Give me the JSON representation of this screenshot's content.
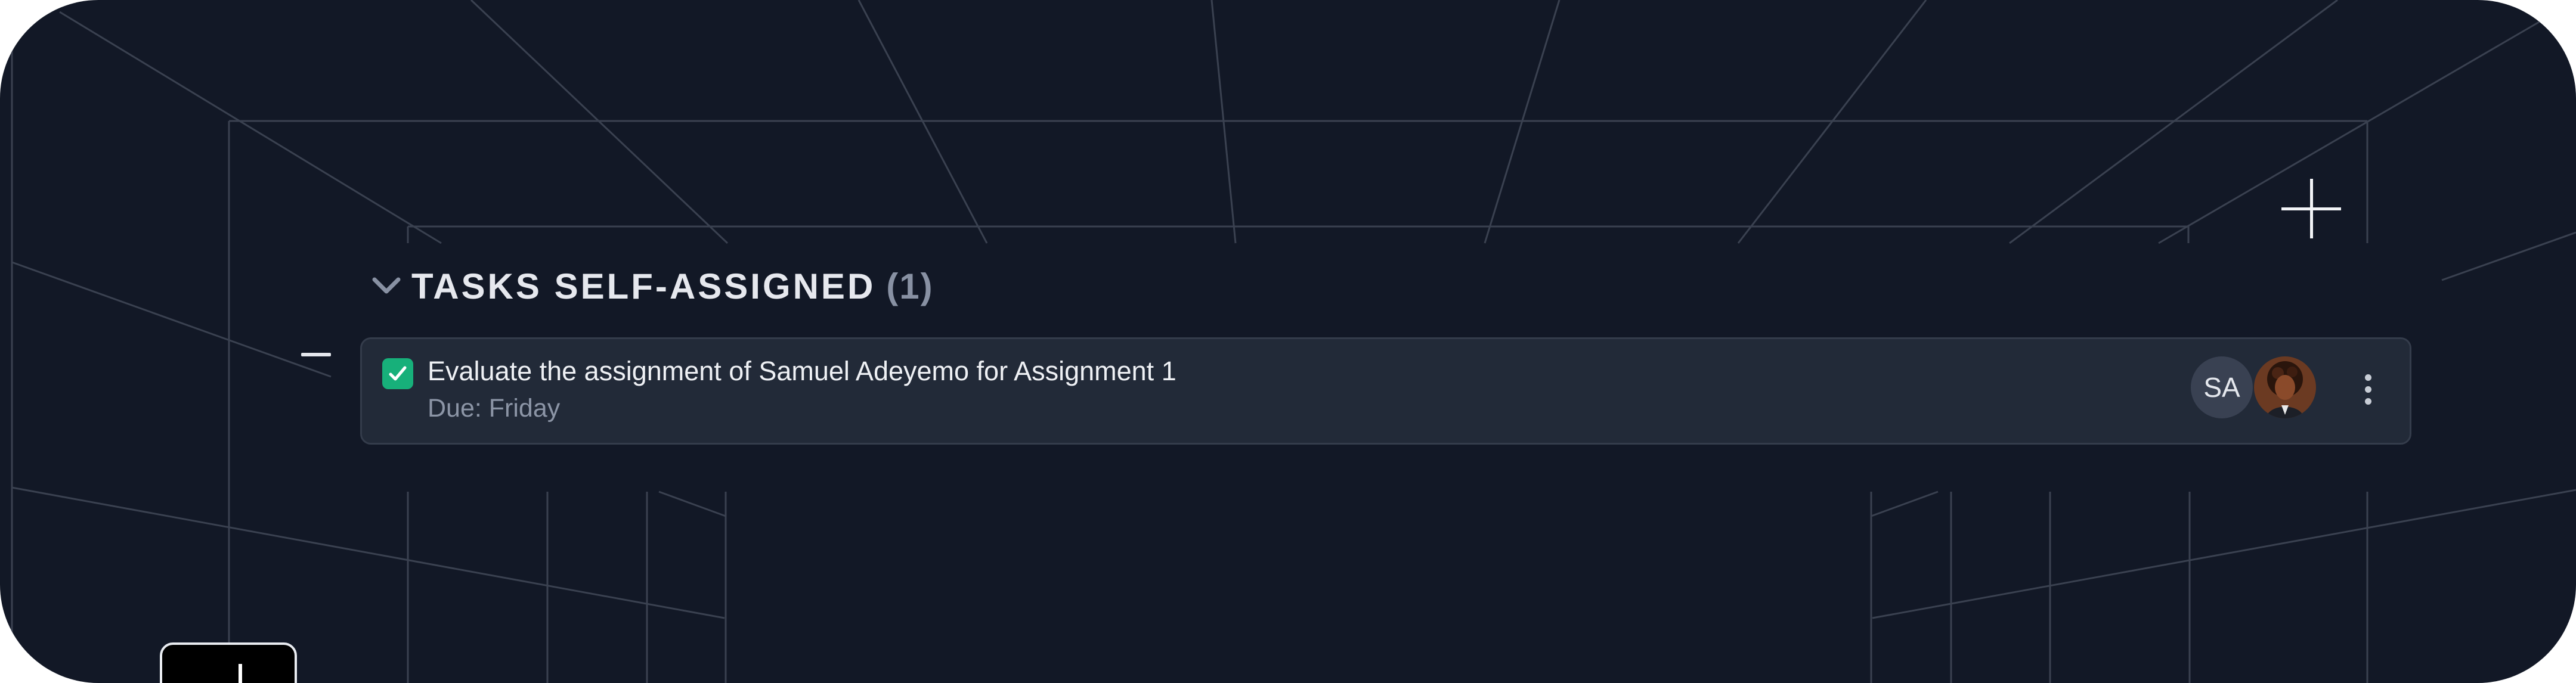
{
  "section": {
    "title": "TASKS SELF-ASSIGNED",
    "count": "(1)"
  },
  "task": {
    "completed": true,
    "title": "Evaluate the assignment of Samuel Adeyemo for Assignment 1",
    "due": "Due: Friday",
    "assignees": {
      "initials": "SA",
      "avatar_icon": "profile-photo"
    }
  },
  "icons": {
    "chevron": "chevron-down-icon",
    "add": "plus-icon",
    "checkbox": "check-icon",
    "menu": "more-vertical-icon",
    "drag": "drag-handle"
  },
  "colors": {
    "background": "#121826",
    "card": "#222a38",
    "accent": "#17b07a",
    "text": "#eef0f4",
    "muted": "#8c95a6"
  }
}
